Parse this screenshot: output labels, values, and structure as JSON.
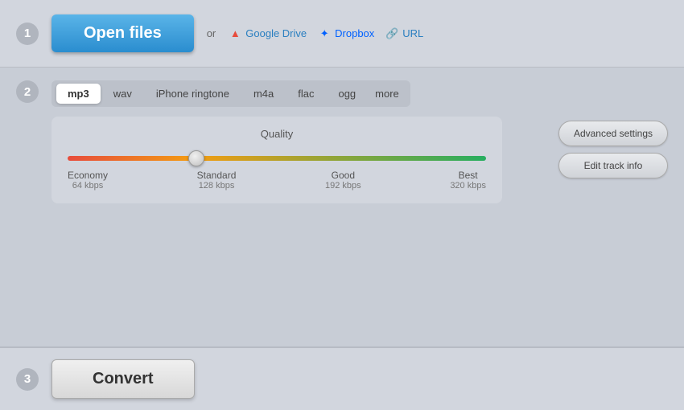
{
  "steps": {
    "step1": "1",
    "step2": "2",
    "step3": "3"
  },
  "section1": {
    "open_files_label": "Open files",
    "or_text": "or",
    "google_drive_label": "Google Drive",
    "dropbox_label": "Dropbox",
    "url_label": "URL"
  },
  "section2": {
    "tabs": [
      {
        "id": "mp3",
        "label": "mp3",
        "active": true
      },
      {
        "id": "wav",
        "label": "wav",
        "active": false
      },
      {
        "id": "iphone-ringtone",
        "label": "iPhone ringtone",
        "active": false
      },
      {
        "id": "m4a",
        "label": "m4a",
        "active": false
      },
      {
        "id": "flac",
        "label": "flac",
        "active": false
      },
      {
        "id": "ogg",
        "label": "ogg",
        "active": false
      }
    ],
    "more_label": "more",
    "quality_title": "Quality",
    "slider_value": 30,
    "quality_labels": [
      {
        "name": "Economy",
        "kbps": "64 kbps"
      },
      {
        "name": "Standard",
        "kbps": "128 kbps"
      },
      {
        "name": "Good",
        "kbps": "192 kbps"
      },
      {
        "name": "Best",
        "kbps": "320 kbps"
      }
    ],
    "advanced_settings_label": "Advanced settings",
    "edit_track_info_label": "Edit track info"
  },
  "section3": {
    "convert_label": "Convert"
  },
  "icons": {
    "google_drive": "▲",
    "dropbox": "✦",
    "url": "🔗"
  }
}
